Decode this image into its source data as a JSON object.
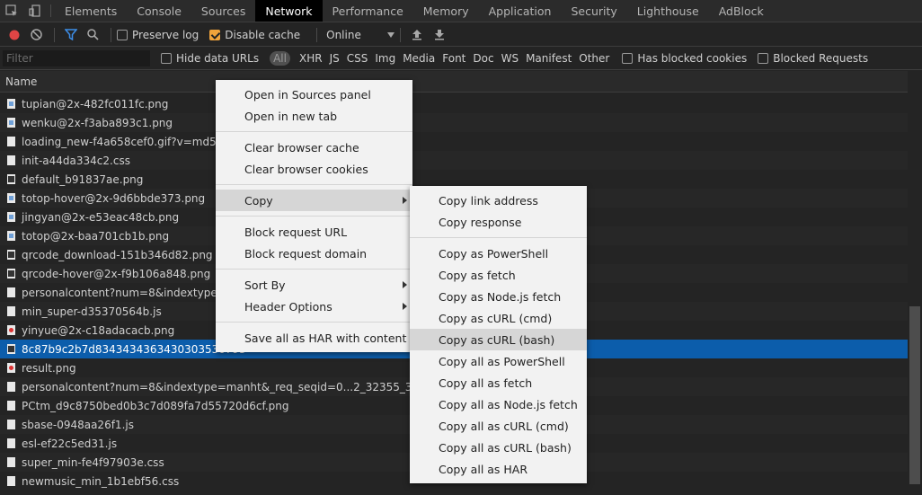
{
  "tabs": [
    "Elements",
    "Console",
    "Sources",
    "Network",
    "Performance",
    "Memory",
    "Application",
    "Security",
    "Lighthouse",
    "AdBlock"
  ],
  "active_tab": "Network",
  "toolbar": {
    "preserve_log": "Preserve log",
    "disable_cache": "Disable cache",
    "throttle": "Online",
    "record_color": "#e04545",
    "accent": "#f0a33b"
  },
  "filter": {
    "placeholder": "Filter",
    "hide_data_urls": "Hide data URLs",
    "types": [
      "All",
      "XHR",
      "JS",
      "CSS",
      "Img",
      "Media",
      "Font",
      "Doc",
      "WS",
      "Manifest",
      "Other"
    ],
    "has_blocked_cookies": "Has blocked cookies",
    "blocked_requests": "Blocked Requests"
  },
  "table": {
    "name_header": "Name",
    "rows": [
      "tupian@2x-482fc011fc.png",
      "wenku@2x-f3aba893c1.png",
      "loading_new-f4a658cef0.gif?v=md5",
      "init-a44da334c2.css",
      "default_b91837ae.png",
      "totop-hover@2x-9d6bbde373.png",
      "jingyan@2x-e53eac48cb.png",
      "totop@2x-baa701cb1b.png",
      "qrcode_download-151b346d82.png",
      "qrcode-hover@2x-f9b106a848.png",
      "personalcontent?num=8&indextype=ma",
      "min_super-d35370564b.js",
      "yinyue@2x-c18adacacb.png",
      "8c87b9c2b7d8343434363430303530793",
      "result.png",
      "personalcontent?num=8&indextype=manht&_req_seqid=0...2_32355_31660_3204",
      "PCtm_d9c8750bed0b3c7d089fa7d55720d6cf.png",
      "sbase-0948aa26f1.js",
      "esl-ef22c5ed31.js",
      "super_min-fe4f97903e.css",
      "newmusic_min_1b1ebf56.css"
    ]
  },
  "context_menu": {
    "open_sources": "Open in Sources panel",
    "open_tab": "Open in new tab",
    "clear_cache": "Clear browser cache",
    "clear_cookies": "Clear browser cookies",
    "copy": "Copy",
    "block_url": "Block request URL",
    "block_domain": "Block request domain",
    "sort_by": "Sort By",
    "header_options": "Header Options",
    "save_har": "Save all as HAR with content"
  },
  "copy_menu": {
    "link": "Copy link address",
    "response": "Copy response",
    "powershell": "Copy as PowerShell",
    "fetch": "Copy as fetch",
    "nodejs": "Copy as Node.js fetch",
    "curl_cmd": "Copy as cURL (cmd)",
    "curl_bash": "Copy as cURL (bash)",
    "all_powershell": "Copy all as PowerShell",
    "all_fetch": "Copy all as fetch",
    "all_nodejs": "Copy all as Node.js fetch",
    "all_curl_cmd": "Copy all as cURL (cmd)",
    "all_curl_bash": "Copy all as cURL (bash)",
    "all_har": "Copy all as HAR"
  }
}
